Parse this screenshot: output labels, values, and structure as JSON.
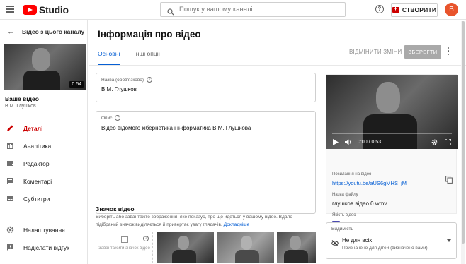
{
  "app": {
    "logo_text": "Studio"
  },
  "search": {
    "placeholder": "Пошук у вашому каналі"
  },
  "header": {
    "create_label": "СТВОРИТИ",
    "avatar_letter": "В"
  },
  "sidebar": {
    "back_label": "Відео з цього каналу",
    "thumbnail_duration": "0:54",
    "your_video_label": "Ваше відео",
    "video_owner": "В.М. Глушков",
    "items": [
      {
        "label": "Деталі",
        "icon": "pencil-icon",
        "active": true
      },
      {
        "label": "Аналітика",
        "icon": "analytics-icon",
        "active": false
      },
      {
        "label": "Редактор",
        "icon": "editor-icon",
        "active": false
      },
      {
        "label": "Коментарі",
        "icon": "comments-icon",
        "active": false
      },
      {
        "label": "Субтитри",
        "icon": "subtitles-icon",
        "active": false
      }
    ],
    "bottom_items": [
      {
        "label": "Налаштування",
        "icon": "gear-icon"
      },
      {
        "label": "Надіслати відгук",
        "icon": "feedback-icon"
      }
    ]
  },
  "main": {
    "title": "Інформація про відео",
    "tabs": [
      {
        "label": "Основні",
        "active": true
      },
      {
        "label": "Інші опції",
        "active": false
      }
    ],
    "undo_label": "ВІДМІНИТИ ЗМІНИ",
    "save_label": "ЗБЕРЕГТИ",
    "title_field": {
      "label": "Назва (обов'язково)",
      "value": "В.М. Глушков"
    },
    "description_field": {
      "label": "Опис",
      "value": "Відео відомого кібернетика і інформатика В.М. Глушкова"
    },
    "thumbnail": {
      "heading": "Значок відео",
      "description": "Виберіть або завантажте зображення, яке показує, про що йдеться у вашому відео. Вдало підібраний значок виділяється й привертає увагу глядачів.",
      "link_text": "Докладніше",
      "upload_label": "Завантажити значок відео"
    }
  },
  "preview": {
    "time": "0:00 / 0:53",
    "progress": 0.0,
    "link_label": "Посилання на відео",
    "link": "https://youtu.be/aUS6gMHS_jM",
    "filename_label": "Назва файлу",
    "filename": "глушков відео 0.wmv",
    "quality_label": "Якість відео",
    "quality_badge": "SD"
  },
  "visibility": {
    "label": "Видимість",
    "value": "Не для всіх",
    "sub": "Призначено для дітей (визначено вами)"
  },
  "colors": {
    "accent": "#065fd4",
    "brand_red": "#ff0000",
    "active_nav": "#cc0000",
    "save_disabled": "#a9a9a9"
  }
}
